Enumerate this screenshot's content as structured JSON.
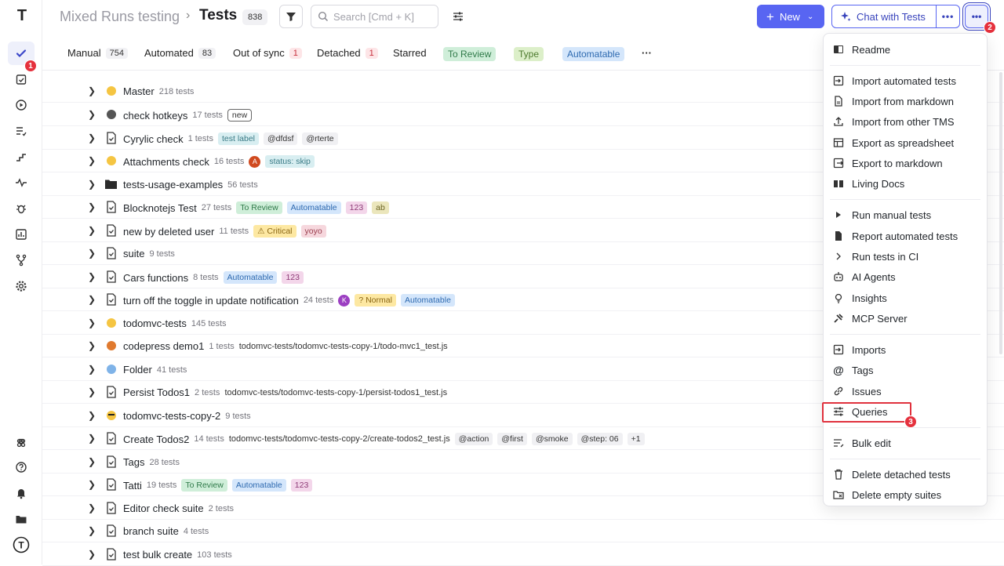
{
  "app": {
    "project": "Mixed Runs testing",
    "title": "Tests",
    "count": "838",
    "logo_letter": "T"
  },
  "search": {
    "placeholder": "Search [Cmd + K]"
  },
  "header": {
    "new_label": "New",
    "chat_label": "Chat with Tests"
  },
  "sidebar": {
    "badge": "1",
    "items": [
      {
        "icon": "check-icon"
      },
      {
        "icon": "clipboard-check-icon"
      },
      {
        "icon": "play-circle-icon"
      },
      {
        "icon": "list-check-icon"
      },
      {
        "icon": "steps-icon"
      },
      {
        "icon": "pulse-icon"
      },
      {
        "icon": "bug-icon"
      },
      {
        "icon": "bar-chart-icon"
      },
      {
        "icon": "branch-icon"
      },
      {
        "icon": "gear-icon"
      },
      {
        "icon": "command-icon"
      },
      {
        "icon": "help-icon"
      },
      {
        "icon": "bell-icon"
      },
      {
        "icon": "folders-icon"
      },
      {
        "icon": "user-logo-icon"
      }
    ]
  },
  "badges": {
    "more": "2",
    "queries": "3"
  },
  "tabs": [
    {
      "label": "Manual",
      "count": "754"
    },
    {
      "label": "Automated",
      "count": "83"
    },
    {
      "label": "Out of sync",
      "count": "1"
    },
    {
      "label": "Detached",
      "count": "1"
    },
    {
      "label": "Starred"
    },
    {
      "label": "To Review"
    },
    {
      "label": "Type"
    },
    {
      "label": "Automatable"
    }
  ],
  "rows": [
    {
      "name": "Master",
      "count": "218 tests"
    },
    {
      "name": "check hotkeys",
      "count": "17 tests",
      "tag": "new"
    },
    {
      "name": "Cyrylic check",
      "count": "1 tests",
      "tags": [
        "test label",
        "@dfdsf",
        "@rterte"
      ]
    },
    {
      "name": "Attachments check",
      "count": "16 tests",
      "avatar": "A",
      "tags": [
        "status: skip"
      ]
    },
    {
      "name": "tests-usage-examples",
      "count": "56 tests"
    },
    {
      "name": "Blocknotejs Test",
      "count": "27 tests",
      "tags": [
        "To Review",
        "Automatable",
        "123",
        "ab"
      ]
    },
    {
      "name": "new by deleted user",
      "count": "11 tests",
      "tags": [
        "⚠ Critical",
        "yoyo"
      ]
    },
    {
      "name": "suite",
      "count": "9 tests"
    },
    {
      "name": "Cars functions",
      "count": "8 tests",
      "tags": [
        "Automatable",
        "123"
      ]
    },
    {
      "name": "turn off the toggle in update notification",
      "count": "24 tests",
      "avatar": "K",
      "tags": [
        "? Normal",
        "Automatable"
      ]
    },
    {
      "name": "todomvc-tests",
      "count": "145 tests"
    },
    {
      "name": "codepress demo1",
      "count": "1 tests",
      "path": "todomvc-tests/todomvc-tests-copy-1/todo-mvc1_test.js"
    },
    {
      "name": "Folder",
      "count": "41 tests"
    },
    {
      "name": "Persist Todos1",
      "count": "2 tests",
      "path": "todomvc-tests/todomvc-tests-copy-1/persist-todos1_test.js"
    },
    {
      "name": "todomvc-tests-copy-2",
      "count": "9 tests"
    },
    {
      "name": "Create Todos2",
      "count": "14 tests",
      "path": "todomvc-tests/todomvc-tests-copy-2/create-todos2_test.js",
      "tags": [
        "@action",
        "@first",
        "@smoke",
        "@step: 06",
        "+1"
      ]
    },
    {
      "name": "Tags",
      "count": "28 tests"
    },
    {
      "name": "Tatti",
      "count": "19 tests",
      "tags": [
        "To Review",
        "Automatable",
        "123"
      ]
    },
    {
      "name": "Editor check suite",
      "count": "2 tests"
    },
    {
      "name": "branch suite",
      "count": "4 tests"
    },
    {
      "name": "test bulk create",
      "count": "103 tests"
    }
  ],
  "menu": [
    {
      "label": "Readme",
      "icon": "book-icon"
    },
    {
      "label": "Import automated tests",
      "icon": "import-icon"
    },
    {
      "label": "Import from markdown",
      "icon": "file-icon"
    },
    {
      "label": "Import from other TMS",
      "icon": "upload-icon"
    },
    {
      "label": "Export as spreadsheet",
      "icon": "table-icon"
    },
    {
      "label": "Export to markdown",
      "icon": "export-icon"
    },
    {
      "label": "Living Docs",
      "icon": "book-open-icon"
    },
    {
      "label": "Run manual tests",
      "icon": "play-icon"
    },
    {
      "label": "Report automated tests",
      "icon": "report-icon"
    },
    {
      "label": "Run tests in CI",
      "icon": "chevron-right-icon"
    },
    {
      "label": "AI Agents",
      "icon": "robot-icon"
    },
    {
      "label": "Insights",
      "icon": "lightbulb-icon"
    },
    {
      "label": "MCP Server",
      "icon": "plug-icon"
    },
    {
      "label": "Imports",
      "icon": "import-icon"
    },
    {
      "label": "Tags",
      "icon": "at-icon"
    },
    {
      "label": "Issues",
      "icon": "link-icon"
    },
    {
      "label": "Queries",
      "icon": "sliders-icon"
    },
    {
      "label": "Bulk edit",
      "icon": "list-edit-icon"
    },
    {
      "label": "Delete detached tests",
      "icon": "trash-icon"
    },
    {
      "label": "Delete empty suites",
      "icon": "folder-x-icon"
    }
  ]
}
